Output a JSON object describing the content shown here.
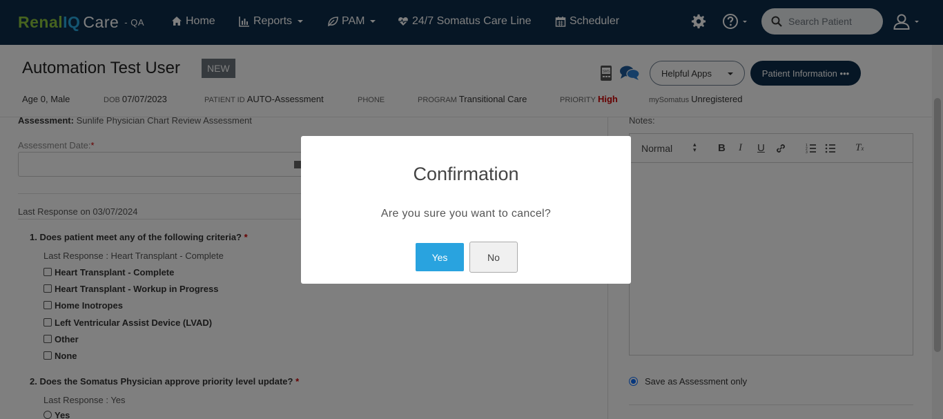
{
  "nav": {
    "brand_renal": "Renal",
    "brand_iq": "IQ",
    "brand_care": "Care",
    "brand_env": "- QA",
    "home": "Home",
    "reports": "Reports",
    "pam": "PAM",
    "careline": "24/7 Somatus Care Line",
    "scheduler": "Scheduler",
    "search_placeholder": "Search Patient"
  },
  "patient": {
    "name": "Automation Test User",
    "badge": "NEW",
    "age_sex": "Age 0, Male",
    "dob_label": "DOB",
    "dob": "07/07/2023",
    "id_label": "PATIENT ID",
    "id": "AUTO-Assessment",
    "phone_label": "PHONE",
    "program_label": "PROGRAM",
    "program": "Transitional Care",
    "priority_label": "PRIORITY",
    "priority": "High",
    "mysomatus_label": "mySomatus",
    "mysomatus": "Unregistered",
    "helpful_apps": "Helpful Apps",
    "patient_info": "Patient Information •••"
  },
  "assessment": {
    "label": "Assessment:",
    "name": "Sunlife Physician Chart Review Assessment",
    "date_label": "Assessment Date:",
    "last_response": "Last Response on 03/07/2024",
    "q1": {
      "title": "1. Does patient meet any of the following criteria?",
      "last": "Last Response : Heart Transplant - Complete",
      "options": [
        "Heart Transplant - Complete",
        "Heart Transplant - Workup in Progress",
        "Home Inotropes",
        "Left Ventricular Assist Device (LVAD)",
        "Other",
        "None"
      ]
    },
    "q2": {
      "title": "2. Does the Somatus Physician approve priority level update?",
      "last": "Last Response : Yes",
      "option_yes": "Yes"
    }
  },
  "notes": {
    "label": "Notes:",
    "format": "Normal",
    "save_option": "Save as Assessment only"
  },
  "modal": {
    "title": "Confirmation",
    "message": "Are you sure you want to cancel?",
    "yes": "Yes",
    "no": "No"
  }
}
